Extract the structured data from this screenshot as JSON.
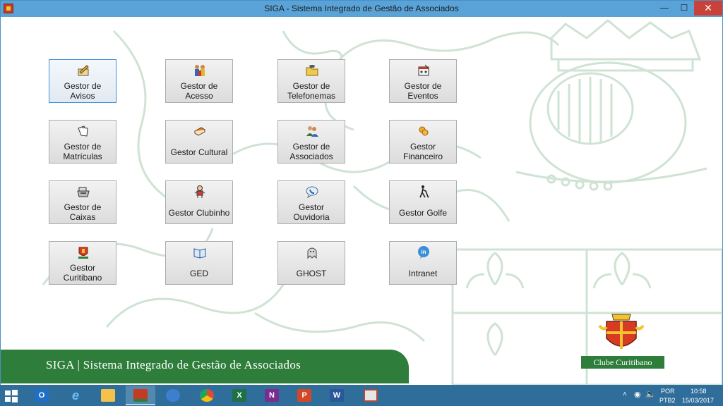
{
  "window": {
    "title": "SIGA - Sistema Integrado de Gestão de Associados"
  },
  "window_controls": {
    "minimize": "—",
    "maximize": "☐",
    "close": "✕"
  },
  "buttons": [
    {
      "label": "Gestor  de\nAvisos",
      "icon": "notepad-pencil-icon"
    },
    {
      "label": "Gestor de\nAcesso",
      "icon": "people-group-icon"
    },
    {
      "label": "Gestor de\nTelefonemas",
      "icon": "phone-folder-icon"
    },
    {
      "label": "Gestor de\nEventos",
      "icon": "calendar-event-icon"
    },
    {
      "label": "Gestor de\nMatrículas",
      "icon": "documents-pen-icon"
    },
    {
      "label": "Gestor Cultural",
      "icon": "books-icon"
    },
    {
      "label": "Gestor de\nAssociados",
      "icon": "users-icon"
    },
    {
      "label": "Gestor\nFinanceiro",
      "icon": "coins-icon"
    },
    {
      "label": "Gestor de\nCaixas",
      "icon": "cash-register-icon"
    },
    {
      "label": "Gestor Clubinho",
      "icon": "kid-icon"
    },
    {
      "label": "Gestor\nOuvidoria",
      "icon": "speech-phone-icon"
    },
    {
      "label": "Gestor Golfe",
      "icon": "golfer-icon"
    },
    {
      "label": "Gestor\nCuritibano",
      "icon": "club-crest-icon"
    },
    {
      "label": "GED",
      "icon": "open-book-icon"
    },
    {
      "label": "GHOST",
      "icon": "ghost-icon"
    },
    {
      "label": "Intranet",
      "icon": "linkedin-bubble-icon"
    }
  ],
  "banner": {
    "text": "SIGA | Sistema Integrado de Gestão de Associados"
  },
  "logo": {
    "label": "Clube Curitibano"
  },
  "taskbar": {
    "apps": [
      {
        "name": "outlook",
        "glyph": "O",
        "color": "#1f6fc4"
      },
      {
        "name": "internet-explorer",
        "glyph": "e",
        "color": "#1e88d6"
      },
      {
        "name": "file-explorer",
        "glyph": "",
        "color": "#f2c24b"
      },
      {
        "name": "siga",
        "glyph": "",
        "color": "#c23b22"
      },
      {
        "name": "pen-app",
        "glyph": "",
        "color": "#3d7fcf"
      },
      {
        "name": "chrome",
        "glyph": "",
        "color": "#dd4b39"
      },
      {
        "name": "excel",
        "glyph": "X",
        "color": "#1e7145"
      },
      {
        "name": "onenote",
        "glyph": "N",
        "color": "#7a2d8f"
      },
      {
        "name": "powerpoint",
        "glyph": "P",
        "color": "#d24726"
      },
      {
        "name": "word",
        "glyph": "W",
        "color": "#2b579a"
      },
      {
        "name": "misc-app",
        "glyph": "",
        "color": "#b34a3a"
      }
    ],
    "tray": {
      "lang": "POR",
      "layout": "PTB2",
      "time": "10:58",
      "date": "15/03/2017"
    }
  }
}
